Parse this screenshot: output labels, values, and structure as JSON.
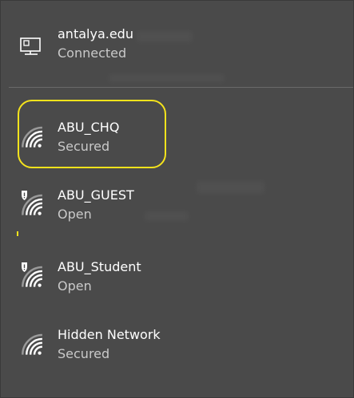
{
  "networks": [
    {
      "name": "antalya.edu",
      "status": "Connected",
      "icon": "ethernet-icon"
    },
    {
      "name": "ABU_CHQ",
      "status": "Secured",
      "icon": "wifi-icon"
    },
    {
      "name": "ABU_GUEST",
      "status": "Open",
      "icon": "wifi-open-shield-icon"
    },
    {
      "name": "ABU_Student",
      "status": "Open",
      "icon": "wifi-open-shield-icon"
    },
    {
      "name": "Hidden Network",
      "status": "Secured",
      "icon": "wifi-icon"
    }
  ],
  "colors": {
    "background": "#4a4a4a",
    "highlight": "#f5e31c",
    "text": "#ffffff",
    "status_text": "#c9c9c9"
  }
}
